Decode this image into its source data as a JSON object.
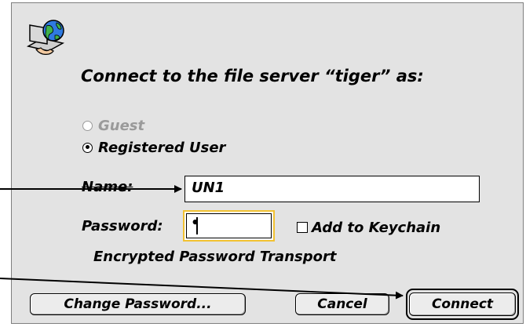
{
  "dialog": {
    "prompt": "Connect to the file server “tiger” as:",
    "guest_label": "Guest",
    "registered_label": "Registered User",
    "name_label": "Name:",
    "name_value": "UN1",
    "password_label": "Password:",
    "password_mask": "•",
    "keychain_label": "Add to Keychain",
    "encrypted_text": "Encrypted Password Transport",
    "selected_login": "Registered User",
    "guest_enabled": false,
    "keychain_checked": false
  },
  "buttons": {
    "change_password": "Change Password...",
    "cancel": "Cancel",
    "connect": "Connect"
  },
  "icons": {
    "server": "file-server-icon"
  },
  "colors": {
    "dialog_bg": "#e3e3e3",
    "focus_ring": "#f2c232",
    "disabled_text": "#9a9a9a"
  }
}
